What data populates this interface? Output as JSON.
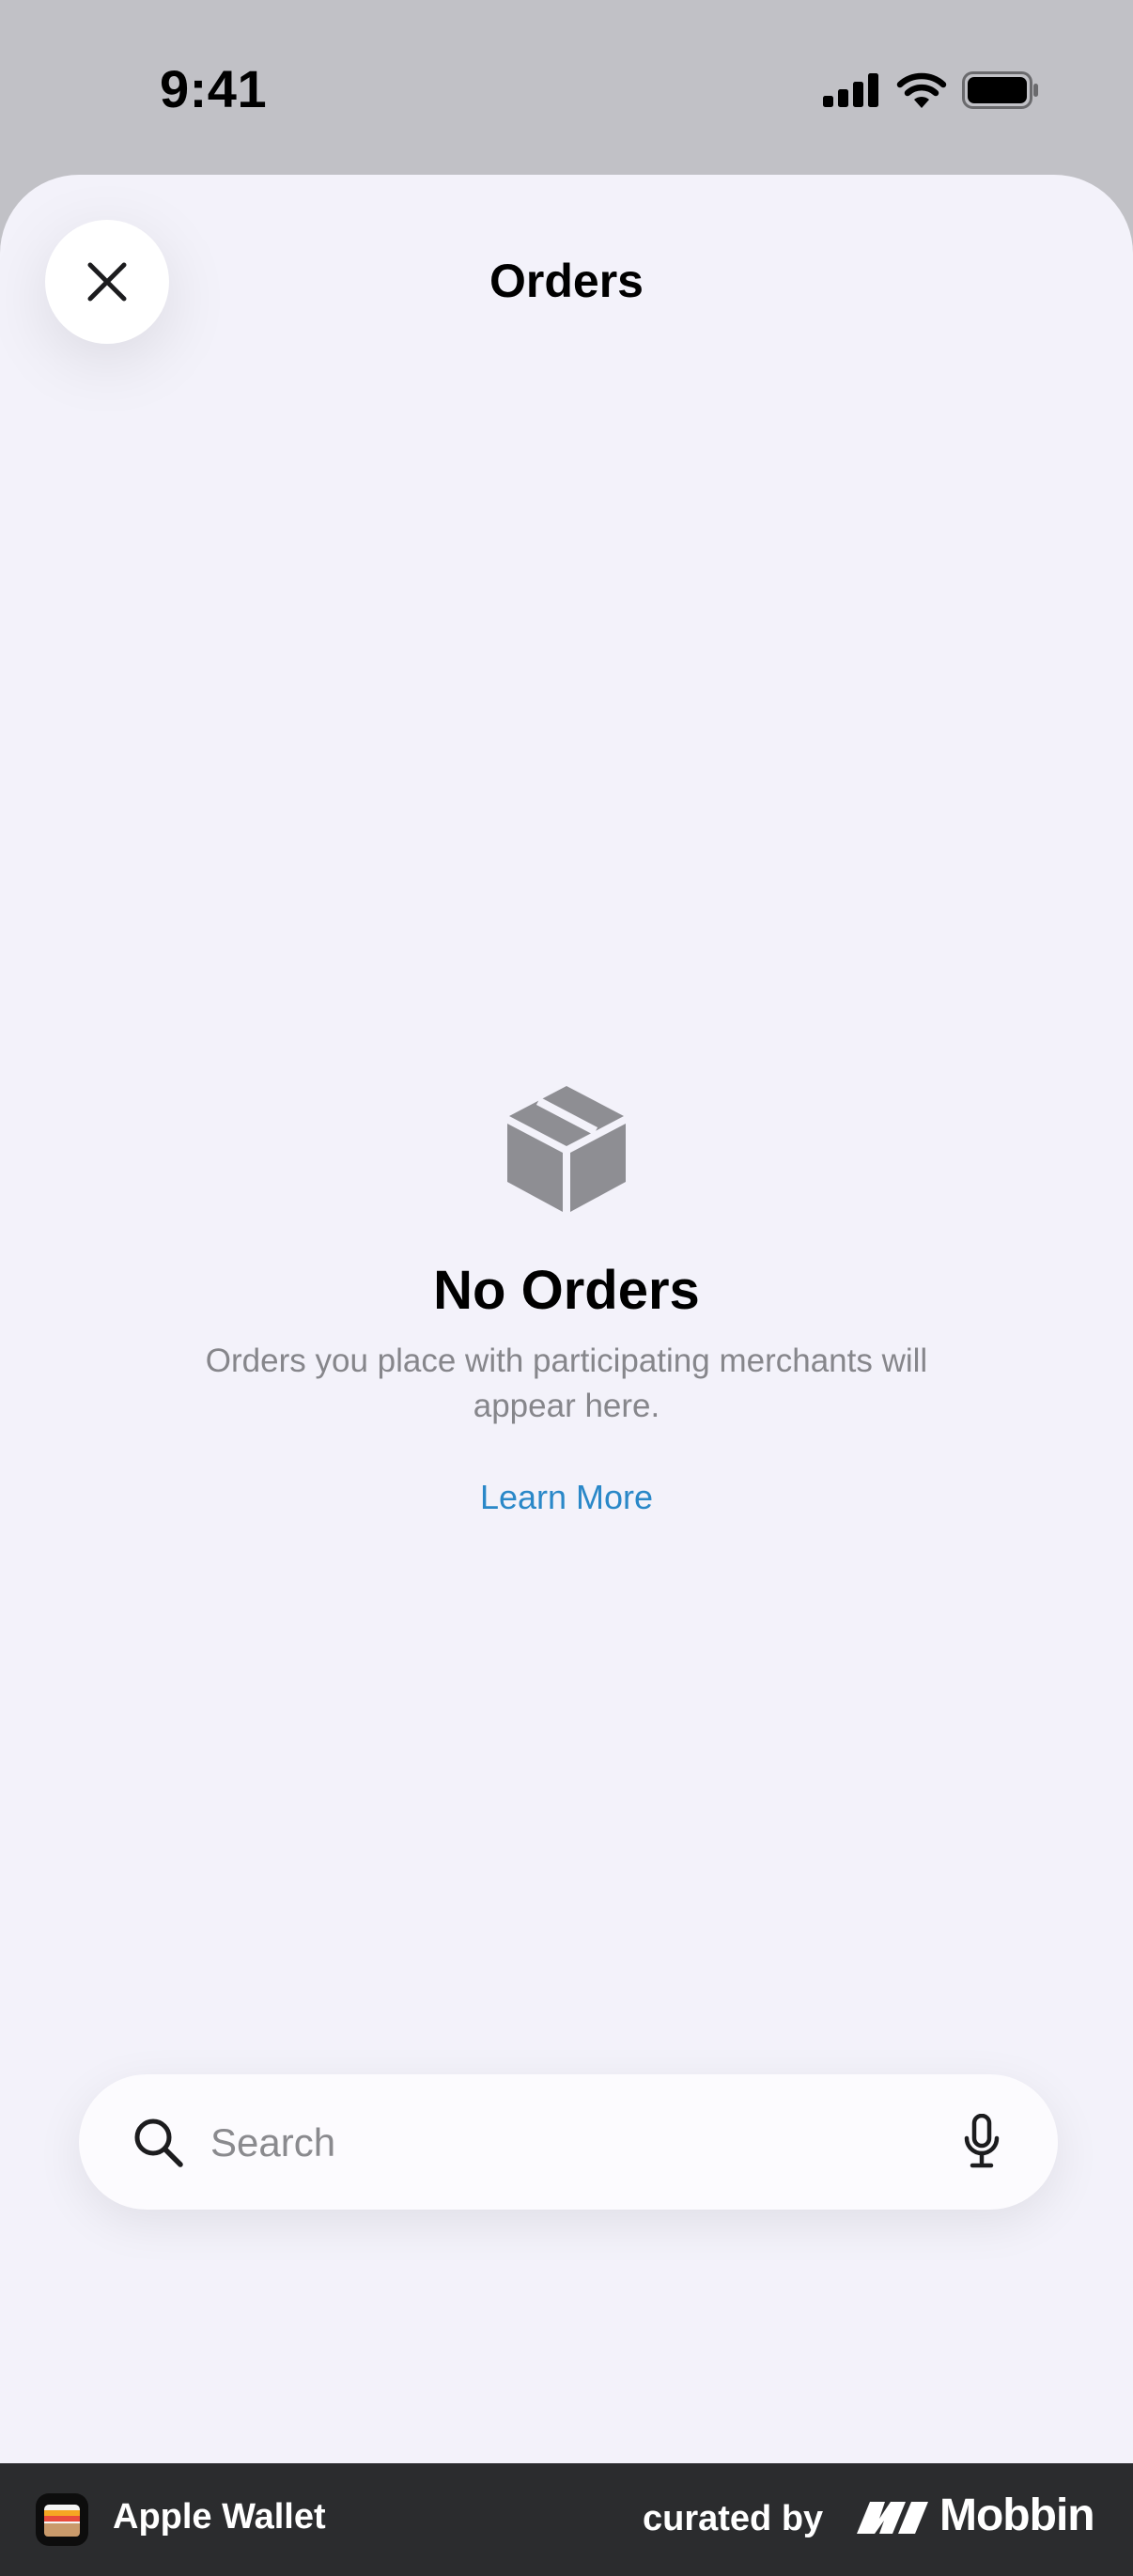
{
  "status_bar": {
    "time": "9:41"
  },
  "header": {
    "title": "Orders"
  },
  "empty_state": {
    "title": "No Orders",
    "description": "Orders you place with participating merchants will appear here.",
    "link_label": "Learn More"
  },
  "search": {
    "placeholder": "Search"
  },
  "footer": {
    "app_name": "Apple Wallet",
    "curated_label": "curated by",
    "brand_name": "Mobbin"
  },
  "colors": {
    "sheet_background": "#f3f2fa",
    "link": "#2a88c8",
    "icon_gray": "#8e8e93",
    "footer_background": "#2b2c2e"
  }
}
